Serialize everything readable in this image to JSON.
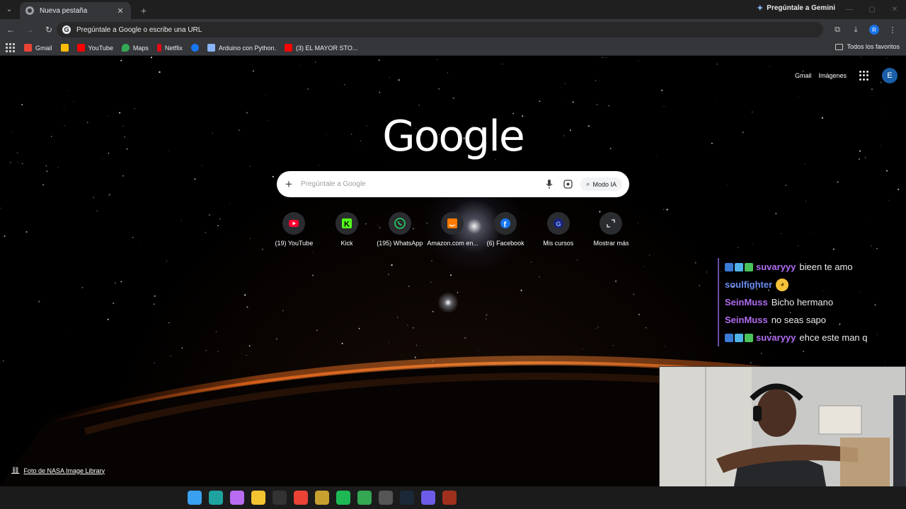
{
  "browser": {
    "tab_title": "Nueva pestaña",
    "tab_close": "✕",
    "new_tab": "+",
    "gemini_label": "Pregúntale a Gemini",
    "omnibox_placeholder": "Pregúntale a Google o escribe una URL",
    "profile_initial": "R",
    "bookmarks": [
      {
        "label": "Gmail",
        "color": "#ea4335"
      },
      {
        "label": "",
        "color": "#fbbc04"
      },
      {
        "label": "YouTube",
        "color": "#ff0000"
      },
      {
        "label": "Maps",
        "color": "#34a853"
      },
      {
        "label": "Netflix",
        "color": "#e50914"
      },
      {
        "label": "",
        "color": "#1877f2"
      },
      {
        "label": "Arduino con Python.",
        "color": "#8ab4f8"
      },
      {
        "label": "(3) EL MAYOR STO...",
        "color": "#ff0000"
      }
    ],
    "all_bookmarks": "Todos los favoritos"
  },
  "page": {
    "header_links": {
      "gmail": "Gmail",
      "images": "Imágenes"
    },
    "account_initial": "E",
    "logo": "Google",
    "search_placeholder": "Pregúntale a Google",
    "ai_mode": "Modo IA",
    "shortcuts": [
      {
        "label": "(19) YouTube",
        "icon": "youtube-icon",
        "color": "#ff0033"
      },
      {
        "label": "Kick",
        "icon": "kick-icon",
        "color": "#53fc18"
      },
      {
        "label": "(195) WhatsApp",
        "icon": "whatsapp-icon",
        "color": "#25d366"
      },
      {
        "label": "Amazon.com en...",
        "icon": "amazon-icon",
        "color": "#ff7a00"
      },
      {
        "label": "(6) Facebook",
        "icon": "facebook-icon",
        "color": "#1877f2"
      },
      {
        "label": "Mis cursos",
        "icon": "courses-icon",
        "color": "#1a237e"
      },
      {
        "label": "Mostrar más",
        "icon": "expand-icon",
        "color": "#e8eaed"
      }
    ],
    "credit": "Foto de NASA Image Library"
  },
  "chat": [
    {
      "user": "suvaryyy",
      "user_color": "#b06cf0",
      "text": "bieen te amo",
      "badges": true
    },
    {
      "user": "soulfighter",
      "user_color": "#6c8cf0",
      "text": "",
      "emote": true,
      "badges": false
    },
    {
      "user": "SeinMuss",
      "user_color": "#b06cf0",
      "text": "Bicho hermano",
      "badges": false
    },
    {
      "user": "SeinMuss",
      "user_color": "#b06cf0",
      "text": "no seas sapo",
      "badges": false
    },
    {
      "user": "suvaryyy",
      "user_color": "#b06cf0",
      "text": "ehce este man q",
      "badges": true
    }
  ],
  "taskbar": [
    {
      "name": "windows-start-icon",
      "color": "#3aa0f0"
    },
    {
      "name": "edge-icon",
      "color": "#1fa3a0"
    },
    {
      "name": "copilot-icon",
      "color": "#b86cf0"
    },
    {
      "name": "file-explorer-icon",
      "color": "#f4c430"
    },
    {
      "name": "epic-games-icon",
      "color": "#333333"
    },
    {
      "name": "chrome-icon",
      "color": "#ea4335"
    },
    {
      "name": "app-icon",
      "color": "#c8a030"
    },
    {
      "name": "spotify-icon",
      "color": "#1db954"
    },
    {
      "name": "chrome-active-icon",
      "color": "#34a853"
    },
    {
      "name": "obs-icon",
      "color": "#555555"
    },
    {
      "name": "steam-icon",
      "color": "#1b2838"
    },
    {
      "name": "dev-app-icon",
      "color": "#6c5ce7"
    },
    {
      "name": "game-app-icon",
      "color": "#a0301e"
    }
  ]
}
